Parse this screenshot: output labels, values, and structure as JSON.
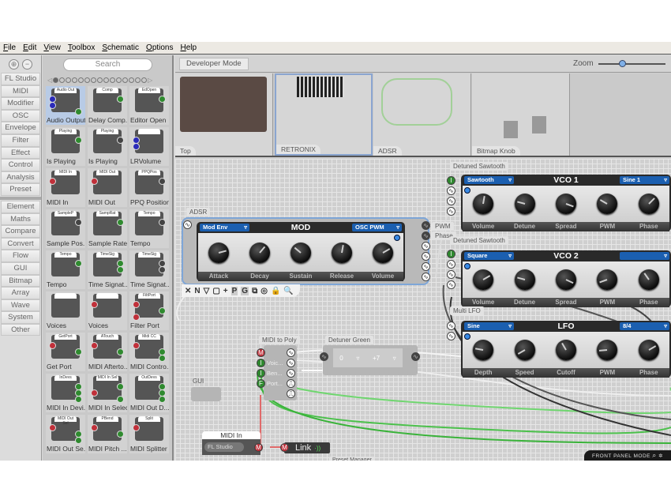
{
  "menu": [
    "File",
    "Edit",
    "View",
    "Toolbox",
    "Schematic",
    "Options",
    "Help"
  ],
  "categories_top": [
    "FL Studio",
    "MIDI",
    "Modifier",
    "OSC",
    "Envelope",
    "Filter",
    "Effect",
    "Control",
    "Analysis",
    "Preset"
  ],
  "categories_bottom": [
    "Element",
    "Maths",
    "Compare",
    "Convert",
    "Flow",
    "GUI",
    "Bitmap",
    "Array",
    "Wave",
    "System",
    "Other"
  ],
  "palette": {
    "search_placeholder": "Search",
    "page_count": 15,
    "current_page": 1,
    "items": [
      {
        "label": "Audio Output",
        "tag": "Audio Out",
        "selected": true
      },
      {
        "label": "Delay Comp...",
        "tag": "Comp"
      },
      {
        "label": "Editor Open",
        "tag": "EdOpen"
      },
      {
        "label": "Is Playing",
        "tag": "Playing"
      },
      {
        "label": "Is Playing",
        "tag": "Playing"
      },
      {
        "label": "LRVolume",
        "tag": ""
      },
      {
        "label": "MIDI In",
        "tag": "MIDI In"
      },
      {
        "label": "MIDI Out",
        "tag": "MIDI Out"
      },
      {
        "label": "PPQ Position",
        "tag": "PPQPos"
      },
      {
        "label": "Sample Pos...",
        "tag": "SampleP"
      },
      {
        "label": "Sample Rate",
        "tag": "SampRat"
      },
      {
        "label": "Tempo",
        "tag": "Tempo"
      },
      {
        "label": "Tempo",
        "tag": "Tempo"
      },
      {
        "label": "Time Signat...",
        "tag": "TimeSig"
      },
      {
        "label": "Time Signat...",
        "tag": "TimeSig"
      },
      {
        "label": "Voices",
        "tag": ""
      },
      {
        "label": "Voices",
        "tag": ""
      },
      {
        "label": "Filter Port",
        "tag": "FiltPort"
      },
      {
        "label": "Get Port",
        "tag": "GetPort"
      },
      {
        "label": "MIDI Afterto...",
        "tag": "ATouch"
      },
      {
        "label": "MIDI Contro...",
        "tag": "Midi CC"
      },
      {
        "label": "MIDI In Devi...",
        "tag": "InDevs"
      },
      {
        "label": "MIDI In Select",
        "tag": "MIDI In Sel"
      },
      {
        "label": "MIDI Out D...",
        "tag": "OutDevs"
      },
      {
        "label": "MIDI Out Se...",
        "tag": "MIDI Out Sel"
      },
      {
        "label": "MIDI Pitch ...",
        "tag": "PBend"
      },
      {
        "label": "MIDI Splitter",
        "tag": "Split"
      }
    ]
  },
  "toolbar": {
    "developer_mode": "Developer Mode",
    "zoom_label": "Zoom",
    "zoom_level": 0.35
  },
  "thumbnails": [
    {
      "label": "Top"
    },
    {
      "label": "RETRONIX",
      "selected": true
    },
    {
      "label": "ADSR"
    },
    {
      "label": "Bitmap Knob"
    }
  ],
  "adsr": {
    "group_tag": "ADSR",
    "title": "MOD",
    "left_select": "Mod Env",
    "right_select": "OSC PWM",
    "knobs": [
      "Attack",
      "Decay",
      "Sustain",
      "Release",
      "Volume"
    ],
    "out_labels": [
      "PWM",
      "Phase"
    ]
  },
  "tools": [
    "✕",
    "N",
    "▽",
    "▢",
    "+",
    "P",
    "G",
    "⧉",
    "◎",
    "🔒",
    "🔍"
  ],
  "vco1": {
    "group_tag": "Detuned Sawtooth",
    "title": "VCO 1",
    "left_select": "Sawtooth",
    "right_select": "Sine 1",
    "knobs": [
      "Volume",
      "Detune",
      "Spread",
      "PWM",
      "Phase"
    ]
  },
  "vco2": {
    "group_tag": "Detuned Sawtooth",
    "title": "VCO 2",
    "left_select": "Square",
    "right_select": "",
    "knobs": [
      "Volume",
      "Detune",
      "Spread",
      "PWM",
      "Phase"
    ]
  },
  "lfo": {
    "group_tag": "Multi LFO",
    "title": "LFO",
    "left_select": "Sine",
    "right_select": "8/4",
    "knobs": [
      "Depth",
      "Speed",
      "Cutoff",
      "PWM",
      "Phase"
    ]
  },
  "midi_to_poly": {
    "title": "MIDI to Poly",
    "inputs": [
      "Voic...",
      "Ben...",
      "Port..."
    ]
  },
  "detuner": {
    "title": "Detuner Green",
    "value1": "0",
    "value2": "+7"
  },
  "gui": {
    "title": "GUI"
  },
  "midi_in": {
    "title": "MIDI In",
    "device": "FL Studio",
    "link": "Link"
  },
  "preset_manager": "Preset Manager",
  "front_panel_mode": "FRONT PANEL MODE"
}
